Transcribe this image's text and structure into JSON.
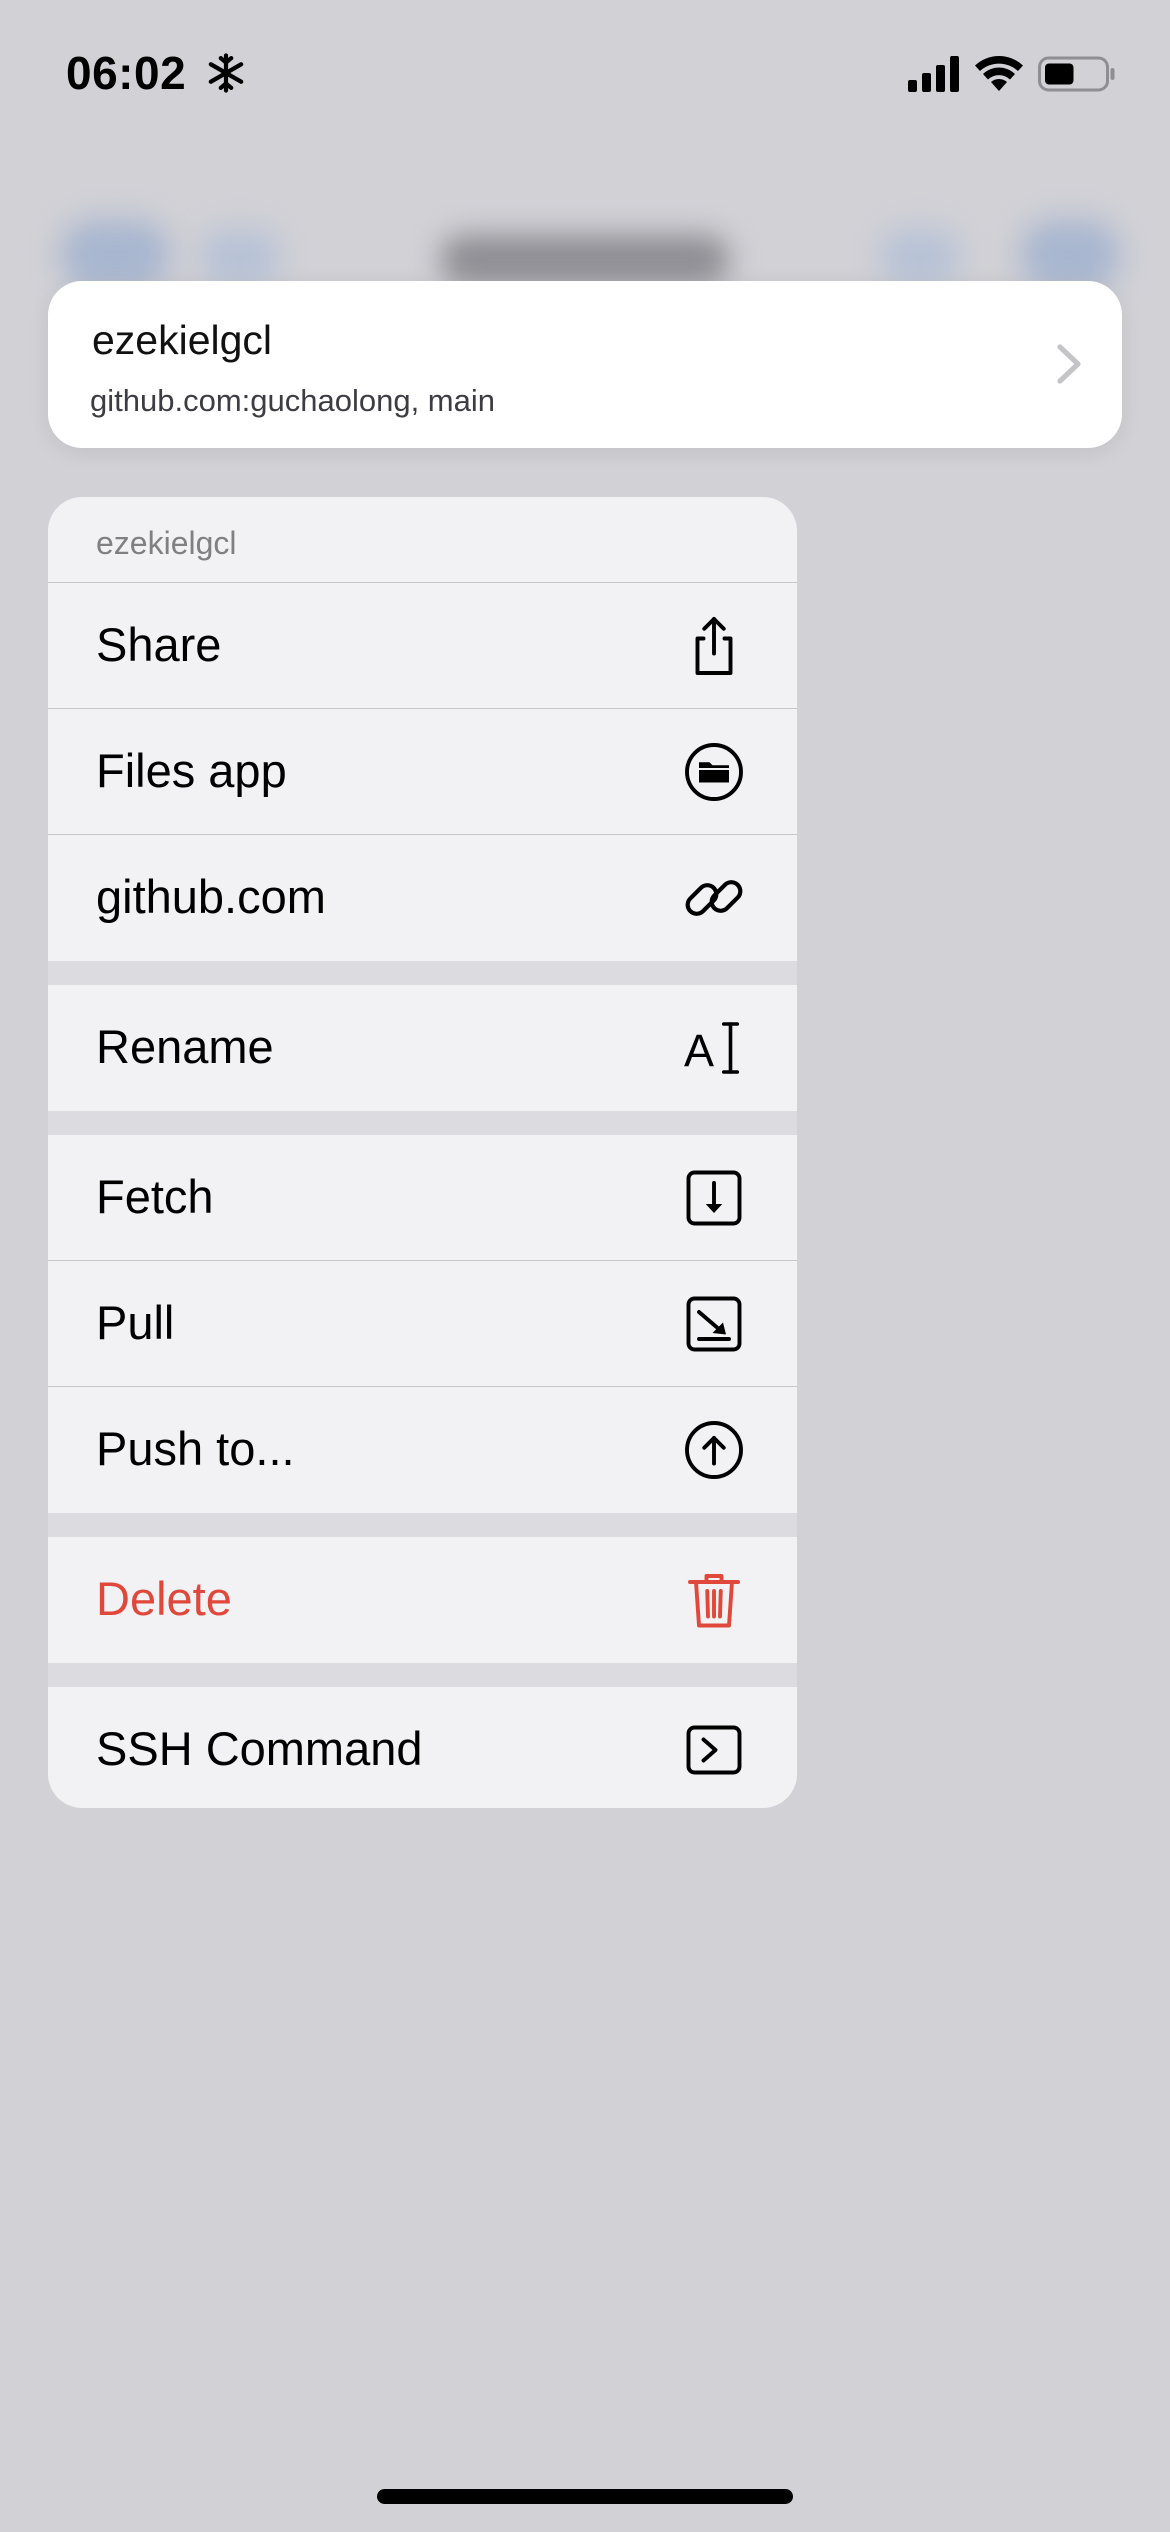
{
  "status_bar": {
    "time": "06:02",
    "snow_icon": "snowflake-icon",
    "battery_level": 0.5
  },
  "preview": {
    "title": "ezekielgcl",
    "subtitle": "github.com:guchaolong, main"
  },
  "menu": {
    "header": "ezekielgcl",
    "items": [
      {
        "label": "Share",
        "icon": "share-icon"
      },
      {
        "label": "Files app",
        "icon": "folder-icon"
      },
      {
        "label": "github.com",
        "icon": "link-icon"
      },
      {
        "label": "Rename",
        "icon": "text-cursor-icon"
      },
      {
        "label": "Fetch",
        "icon": "fetch-icon"
      },
      {
        "label": "Pull",
        "icon": "pull-icon"
      },
      {
        "label": "Push to...",
        "icon": "push-icon"
      },
      {
        "label": "Delete",
        "icon": "trash-icon",
        "color": "#e0483c"
      },
      {
        "label": "SSH Command",
        "icon": "terminal-icon"
      }
    ]
  },
  "colors": {
    "background": "#d1d1d6",
    "menu_bg": "#f2f2f5",
    "destructive": "#e0483c"
  }
}
